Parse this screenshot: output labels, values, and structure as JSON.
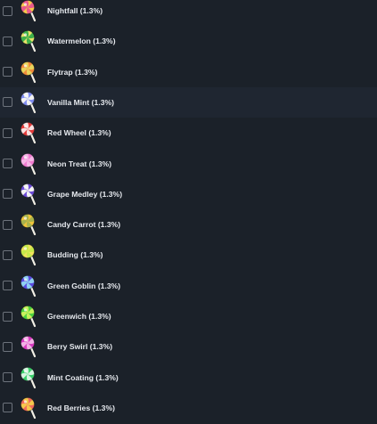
{
  "items": [
    {
      "label": "Nightfall (1.3%)",
      "c1": "#f5c94c",
      "c2": "#e85a8c",
      "checked": false,
      "icon": "lollipop-icon"
    },
    {
      "label": "Watermelon (1.3%)",
      "c1": "#e8e26a",
      "c2": "#3fb04a",
      "checked": false,
      "icon": "lollipop-icon"
    },
    {
      "label": "Flytrap (1.3%)",
      "c1": "#f08a3c",
      "c2": "#e8d45c",
      "checked": false,
      "icon": "lollipop-icon"
    },
    {
      "label": "Vanilla Mint (1.3%)",
      "c1": "#7f8cf0",
      "c2": "#f2f2f2",
      "checked": false,
      "icon": "lollipop-icon"
    },
    {
      "label": "Red Wheel (1.3%)",
      "c1": "#e23a3a",
      "c2": "#f8e1e1",
      "checked": false,
      "icon": "lollipop-icon"
    },
    {
      "label": "Neon Treat (1.3%)",
      "c1": "#f07ad0",
      "c2": "#f5b6e6",
      "checked": false,
      "icon": "lollipop-icon"
    },
    {
      "label": "Grape Medley (1.3%)",
      "c1": "#6b4ad6",
      "c2": "#f2f2f2",
      "checked": false,
      "icon": "lollipop-icon"
    },
    {
      "label": "Candy Carrot (1.3%)",
      "c1": "#f0c43c",
      "c2": "#a8b24c",
      "checked": false,
      "icon": "lollipop-icon"
    },
    {
      "label": "Budding (1.3%)",
      "c1": "#f0e25c",
      "c2": "#c6e84a",
      "checked": false,
      "icon": "lollipop-icon"
    },
    {
      "label": "Green Goblin (1.3%)",
      "c1": "#5a4ae0",
      "c2": "#8fd0f2",
      "checked": false,
      "icon": "lollipop-icon"
    },
    {
      "label": "Greenwich (1.3%)",
      "c1": "#4ad040",
      "c2": "#c8f05c",
      "checked": false,
      "icon": "lollipop-icon"
    },
    {
      "label": "Berry Swirl (1.3%)",
      "c1": "#d83ac0",
      "c2": "#f2b2e6",
      "checked": false,
      "icon": "lollipop-icon"
    },
    {
      "label": "Mint Coating (1.3%)",
      "c1": "#3ad06a",
      "c2": "#d6f5e0",
      "checked": false,
      "icon": "lollipop-icon"
    },
    {
      "label": "Red Berries (1.3%)",
      "c1": "#f06a5c",
      "c2": "#f5c84c",
      "checked": false,
      "icon": "lollipop-icon"
    }
  ],
  "colors": {
    "background": "#1b2129",
    "row_highlight": "#1f2631",
    "text": "#e6e9ee",
    "checkbox_border": "#6d737c",
    "stick": "#f3f0e6"
  }
}
